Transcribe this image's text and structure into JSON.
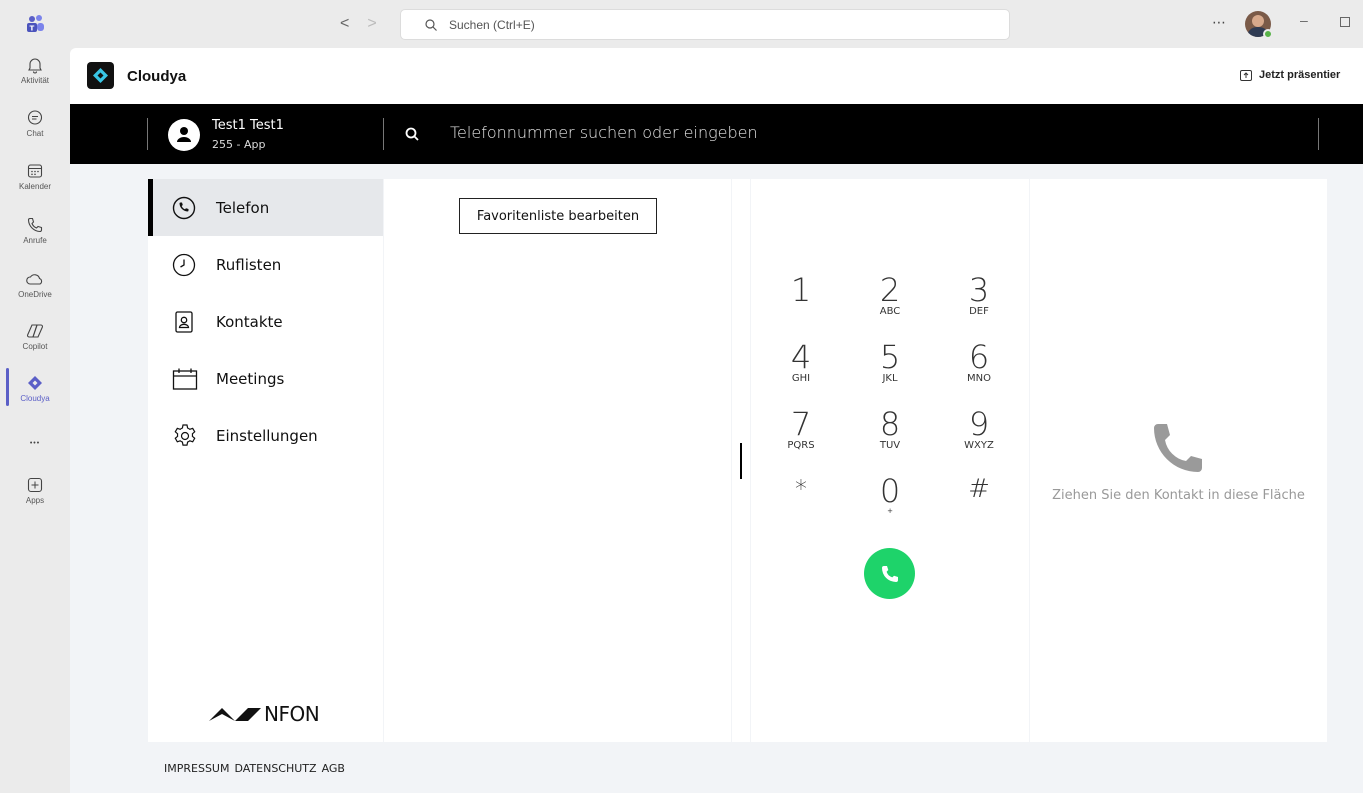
{
  "titlebar": {
    "search_placeholder": "Suchen (Ctrl+E)",
    "back_arrow": "<",
    "forward_arrow": ">",
    "more": "⋯",
    "minimize": "–"
  },
  "rail": {
    "items": [
      {
        "label": "Aktivität",
        "icon": "bell-icon"
      },
      {
        "label": "Chat",
        "icon": "chat-icon"
      },
      {
        "label": "Kalender",
        "icon": "calendar-icon"
      },
      {
        "label": "Anrufe",
        "icon": "phone-icon"
      },
      {
        "label": "OneDrive",
        "icon": "cloud-icon"
      },
      {
        "label": "Copilot",
        "icon": "copilot-icon"
      },
      {
        "label": "Cloudya",
        "icon": "cloudya-icon",
        "active": true
      },
      {
        "label": "",
        "icon": "more-icon"
      },
      {
        "label": "Apps",
        "icon": "add-app-icon"
      }
    ],
    "more": "•••",
    "accent_color": "#5b5fc7"
  },
  "app_header": {
    "title": "Cloudya",
    "present_label": "Jetzt präsentier"
  },
  "user_bar": {
    "name": "Test1 Test1",
    "extension": "255 - App",
    "search_placeholder": "Telefonnummer suchen oder eingeben"
  },
  "nav": {
    "items": [
      {
        "label": "Telefon",
        "icon": "phone-icon",
        "active": true
      },
      {
        "label": "Ruflisten",
        "icon": "clock-icon"
      },
      {
        "label": "Kontakte",
        "icon": "contact-card-icon"
      },
      {
        "label": "Meetings",
        "icon": "calendar-icon"
      },
      {
        "label": "Einstellungen",
        "icon": "gear-icon"
      }
    ],
    "brand": "NFON"
  },
  "favorites": {
    "edit_button": "Favoritenliste bearbeiten"
  },
  "dialpad": {
    "keys": [
      {
        "digit": "1",
        "letters": ""
      },
      {
        "digit": "2",
        "letters": "ABC"
      },
      {
        "digit": "3",
        "letters": "DEF"
      },
      {
        "digit": "4",
        "letters": "GHI"
      },
      {
        "digit": "5",
        "letters": "JKL"
      },
      {
        "digit": "6",
        "letters": "MNO"
      },
      {
        "digit": "7",
        "letters": "PQRS"
      },
      {
        "digit": "8",
        "letters": "TUV"
      },
      {
        "digit": "9",
        "letters": "WXYZ"
      },
      {
        "digit": "*",
        "letters": ""
      },
      {
        "digit": "0",
        "letters": "+"
      },
      {
        "digit": "#",
        "letters": ""
      }
    ],
    "call_color": "#1ed36a"
  },
  "drop_zone": {
    "text": "Ziehen Sie den Kontakt in diese Fläche"
  },
  "footer": {
    "impressum": "IMPRESSUM",
    "datenschutz": "DATENSCHUTZ",
    "agb": "AGB"
  }
}
